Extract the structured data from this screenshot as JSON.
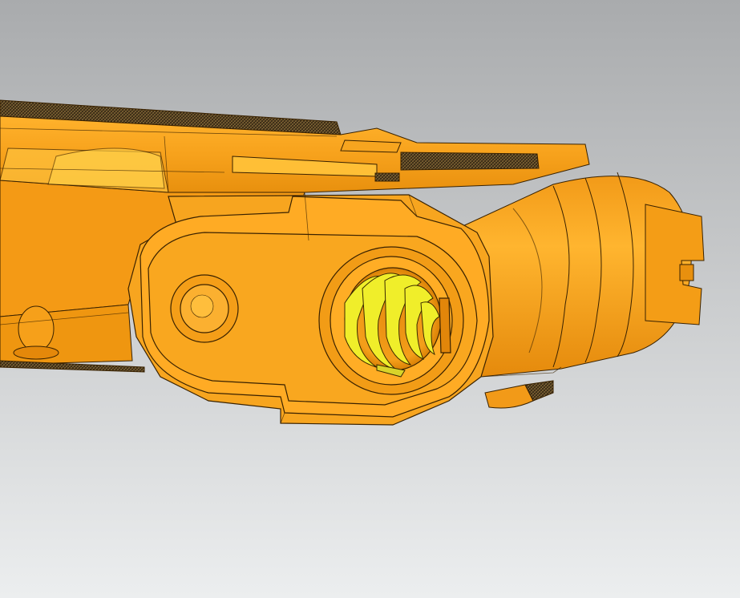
{
  "viewport": {
    "background_top": "#a9abad",
    "background_bottom": "#eceeef"
  },
  "model": {
    "part_color": "#f7a51f",
    "part_shade": "#e08a0a",
    "part_highlight": "#ffc13a",
    "edge_color": "#3a2200",
    "spring_color": "#f0ee2a",
    "knurl_color": "#2a2a2a"
  }
}
